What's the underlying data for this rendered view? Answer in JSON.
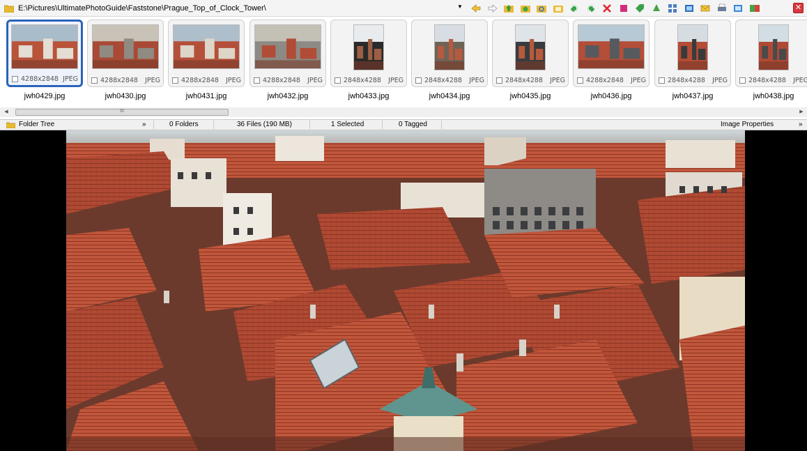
{
  "path": {
    "text": "E:\\Pictures\\UltimatePhotoGuide\\Faststone\\Prague_Top_of_Clock_Tower\\"
  },
  "toolbar": {
    "icons": [
      "back-arrow-icon",
      "forward-arrow-icon",
      "folder-up-icon",
      "folder-green-icon",
      "folder-refresh-icon",
      "folder-open-icon",
      "rotate-left-icon",
      "rotate-right-icon",
      "delete-x-icon",
      "stop-icon",
      "tag-icon",
      "recycle-icon",
      "grid-icon",
      "resize-icon",
      "email-icon",
      "print-icon",
      "slideshow-icon",
      "compare-icon"
    ]
  },
  "thumbnails": [
    {
      "name": "jwh0429.jpg",
      "dims": "4288x2848",
      "type": "JPEG",
      "orient": "landscape",
      "selected": true
    },
    {
      "name": "jwh0430.jpg",
      "dims": "4288x2848",
      "type": "JPEG",
      "orient": "landscape",
      "selected": false
    },
    {
      "name": "jwh0431.jpg",
      "dims": "4288x2848",
      "type": "JPEG",
      "orient": "landscape",
      "selected": false
    },
    {
      "name": "jwh0432.jpg",
      "dims": "4288x2848",
      "type": "JPEG",
      "orient": "landscape",
      "selected": false
    },
    {
      "name": "jwh0433.jpg",
      "dims": "2848x4288",
      "type": "JPEG",
      "orient": "portrait",
      "selected": false
    },
    {
      "name": "jwh0434.jpg",
      "dims": "2848x4288",
      "type": "JPEG",
      "orient": "portrait",
      "selected": false
    },
    {
      "name": "jwh0435.jpg",
      "dims": "2848x4288",
      "type": "JPEG",
      "orient": "portrait",
      "selected": false
    },
    {
      "name": "jwh0436.jpg",
      "dims": "4288x2848",
      "type": "JPEG",
      "orient": "landscape",
      "selected": false
    },
    {
      "name": "jwh0437.jpg",
      "dims": "2848x4288",
      "type": "JPEG",
      "orient": "portrait",
      "selected": false
    },
    {
      "name": "jwh0438.jpg",
      "dims": "2848x4288",
      "type": "JPEG",
      "orient": "portrait",
      "selected": false
    }
  ],
  "scrollbar": {
    "grip": "III"
  },
  "status": {
    "folder_tree": "Folder Tree",
    "collapse": "»",
    "folders": "0 Folders",
    "files": "36 Files (190 MB)",
    "selected": "1 Selected",
    "tagged": "0 Tagged",
    "properties": "Image Properties",
    "properties_collapse": "»"
  },
  "colors": {
    "selection": "#2b63b8",
    "roof_red": "#b5402c",
    "close_red": "#d8383e"
  }
}
